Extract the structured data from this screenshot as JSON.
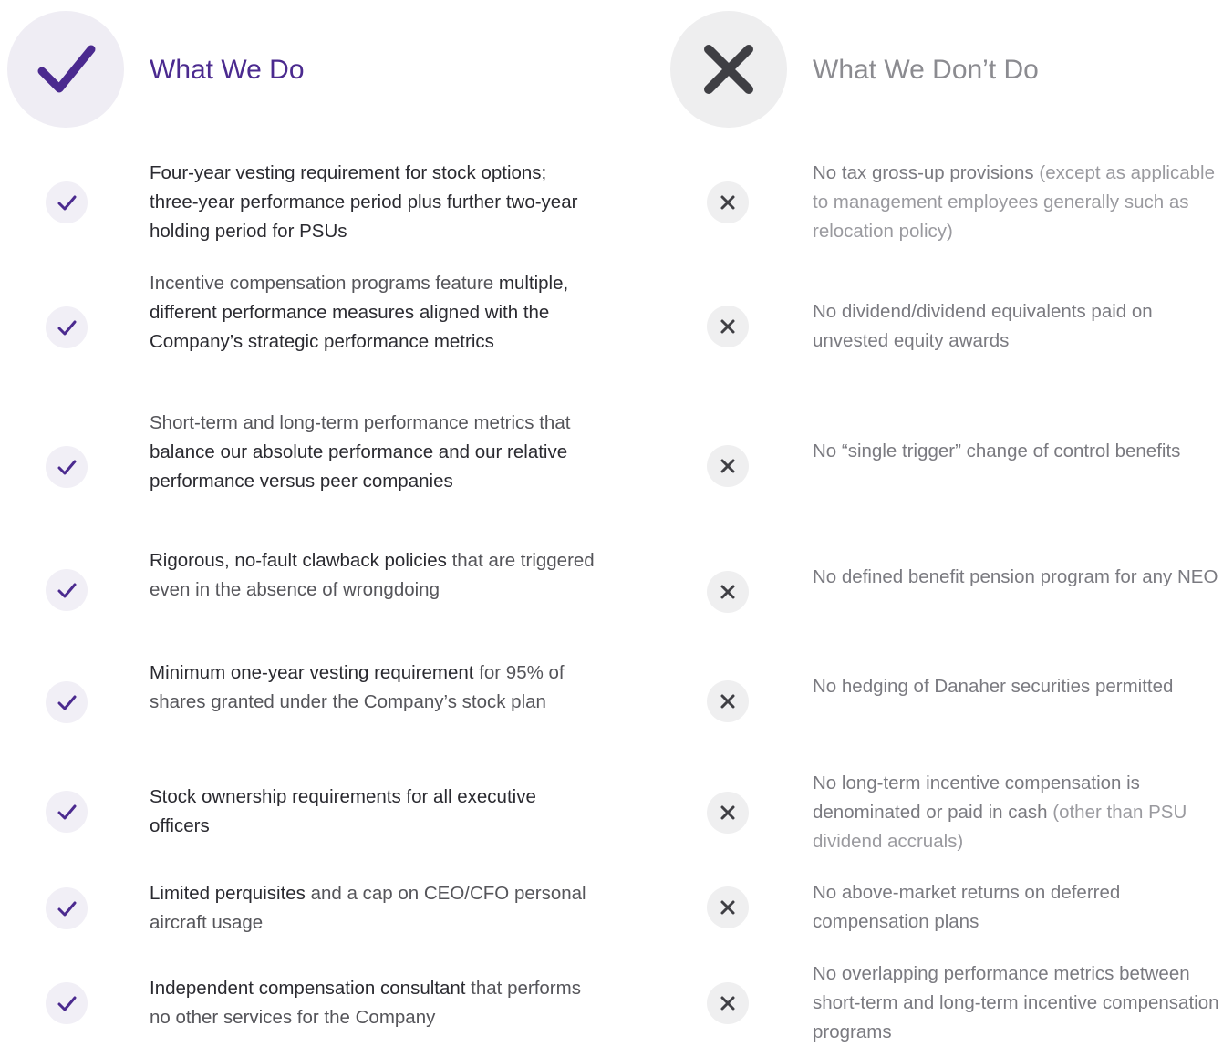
{
  "left": {
    "title": "What We Do",
    "icon": "checkmark-icon",
    "accent": "#4b2a8f",
    "items": [
      {
        "parts": [
          {
            "t": "Four-year vesting requirement for stock options; three-year performance period plus further two-year holding period for PSUs",
            "b": true
          }
        ]
      },
      {
        "parts": [
          {
            "t": "Incentive compensation programs feature ",
            "b": false
          },
          {
            "t": "multiple, different performance measures aligned with the Company’s strategic performance metrics",
            "b": true
          }
        ]
      },
      {
        "parts": [
          {
            "t": "Short-term and long-term performance metrics that ",
            "b": false
          },
          {
            "t": "balance our absolute performance and our relative performance versus peer companies",
            "b": true
          }
        ]
      },
      {
        "parts": [
          {
            "t": "Rigorous, no-fault clawback policies",
            "b": true
          },
          {
            "t": " that are triggered even in the absence of wrongdoing",
            "b": false
          }
        ]
      },
      {
        "parts": [
          {
            "t": "Minimum one-year vesting requirement",
            "b": true
          },
          {
            "t": " for 95% of shares granted under the Company’s stock plan",
            "b": false
          }
        ]
      },
      {
        "parts": [
          {
            "t": "Stock ownership requirements for all executive officers",
            "b": true
          }
        ]
      },
      {
        "parts": [
          {
            "t": "Limited perquisites",
            "b": true
          },
          {
            "t": " and a cap on CEO/CFO personal aircraft usage",
            "b": false
          }
        ]
      },
      {
        "parts": [
          {
            "t": "Independent compensation consultant",
            "b": true
          },
          {
            "t": " that performs no other services for the Company",
            "b": false
          }
        ]
      }
    ]
  },
  "right": {
    "title": "What We Don’t Do",
    "icon": "x-mark-icon",
    "accent": "#3f3f44",
    "items": [
      {
        "parts": [
          {
            "t": "No tax gross-up provisions",
            "b": true
          },
          {
            "t": " (except as applicable to management employees generally such as relocation policy)",
            "b": false
          }
        ]
      },
      {
        "parts": [
          {
            "t": "No dividend/dividend equivalents paid on unvested equity awards",
            "b": true
          }
        ]
      },
      {
        "parts": [
          {
            "t": "No “single trigger” change of control benefits",
            "b": true
          }
        ]
      },
      {
        "parts": [
          {
            "t": "No defined benefit pension program for any NEO",
            "b": true
          }
        ]
      },
      {
        "parts": [
          {
            "t": "No hedging of Danaher securities permitted",
            "b": true
          }
        ]
      },
      {
        "parts": [
          {
            "t": "No long-term incentive compensation is denominated or paid in cash",
            "b": true
          },
          {
            "t": " (other than PSU dividend accruals)",
            "b": false
          }
        ]
      },
      {
        "parts": [
          {
            "t": "No above-market returns on deferred compensation plans",
            "b": true
          }
        ]
      },
      {
        "parts": [
          {
            "t": "No overlapping performance metrics between short-term and long-term incentive compensation programs",
            "b": true
          }
        ]
      }
    ]
  }
}
